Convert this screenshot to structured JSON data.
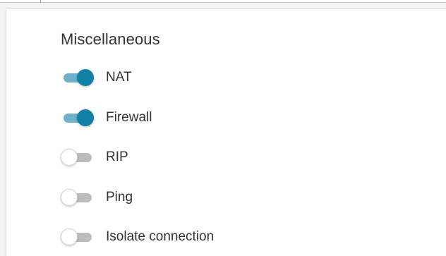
{
  "section": {
    "title": "Miscellaneous"
  },
  "options": [
    {
      "label": "NAT",
      "enabled": true
    },
    {
      "label": "Firewall",
      "enabled": true
    },
    {
      "label": "RIP",
      "enabled": false
    },
    {
      "label": "Ping",
      "enabled": false
    },
    {
      "label": "Isolate connection",
      "enabled": false
    }
  ],
  "colors": {
    "accent": "#1181a6",
    "accent_track": "#6fb2c7",
    "off_track": "#bdbdbd",
    "text": "#333333"
  }
}
